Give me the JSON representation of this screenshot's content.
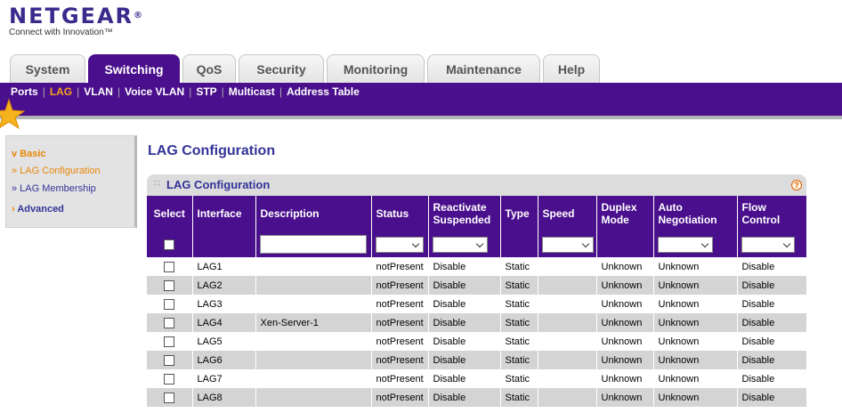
{
  "brand": {
    "name": "NETGEAR",
    "reg": "®",
    "tagline": "Connect with Innovation™"
  },
  "tabs": [
    {
      "label": "System",
      "active": false
    },
    {
      "label": "Switching",
      "active": true
    },
    {
      "label": "QoS",
      "active": false
    },
    {
      "label": "Security",
      "active": false
    },
    {
      "label": "Monitoring",
      "active": false
    },
    {
      "label": "Maintenance",
      "active": false
    },
    {
      "label": "Help",
      "active": false
    }
  ],
  "subnav": [
    {
      "label": "Ports",
      "active": false
    },
    {
      "label": "LAG",
      "active": true
    },
    {
      "label": "VLAN",
      "active": false
    },
    {
      "label": "Voice VLAN",
      "active": false
    },
    {
      "label": "STP",
      "active": false
    },
    {
      "label": "Multicast",
      "active": false
    },
    {
      "label": "Address Table",
      "active": false
    }
  ],
  "sidebar": {
    "basic": "Basic",
    "basic_marker": "v",
    "lag_configuration": "» LAG Configuration",
    "lag_membership": "» LAG Membership",
    "advanced": "Advanced",
    "advanced_marker": "›"
  },
  "page_title": "LAG Configuration",
  "panel": {
    "title": "LAG Configuration",
    "help_glyph": "?"
  },
  "table": {
    "headers": [
      "Select",
      "Interface",
      "Description",
      "Status",
      "Reactivate Suspended",
      "Type",
      "Speed",
      "Duplex Mode",
      "Auto Negotiation",
      "Flow Control"
    ],
    "rows": [
      {
        "interface": "LAG1",
        "description": "",
        "status": "notPresent",
        "reactivate": "Disable",
        "type": "Static",
        "speed": "",
        "duplex": "Unknown",
        "autoneg": "Unknown",
        "flow": "Disable"
      },
      {
        "interface": "LAG2",
        "description": "",
        "status": "notPresent",
        "reactivate": "Disable",
        "type": "Static",
        "speed": "",
        "duplex": "Unknown",
        "autoneg": "Unknown",
        "flow": "Disable"
      },
      {
        "interface": "LAG3",
        "description": "",
        "status": "notPresent",
        "reactivate": "Disable",
        "type": "Static",
        "speed": "",
        "duplex": "Unknown",
        "autoneg": "Unknown",
        "flow": "Disable"
      },
      {
        "interface": "LAG4",
        "description": "Xen-Server-1",
        "status": "notPresent",
        "reactivate": "Disable",
        "type": "Static",
        "speed": "",
        "duplex": "Unknown",
        "autoneg": "Unknown",
        "flow": "Disable"
      },
      {
        "interface": "LAG5",
        "description": "",
        "status": "notPresent",
        "reactivate": "Disable",
        "type": "Static",
        "speed": "",
        "duplex": "Unknown",
        "autoneg": "Unknown",
        "flow": "Disable"
      },
      {
        "interface": "LAG6",
        "description": "",
        "status": "notPresent",
        "reactivate": "Disable",
        "type": "Static",
        "speed": "",
        "duplex": "Unknown",
        "autoneg": "Unknown",
        "flow": "Disable"
      },
      {
        "interface": "LAG7",
        "description": "",
        "status": "notPresent",
        "reactivate": "Disable",
        "type": "Static",
        "speed": "",
        "duplex": "Unknown",
        "autoneg": "Unknown",
        "flow": "Disable"
      },
      {
        "interface": "LAG8",
        "description": "",
        "status": "notPresent",
        "reactivate": "Disable",
        "type": "Static",
        "speed": "",
        "duplex": "Unknown",
        "autoneg": "Unknown",
        "flow": "Disable"
      }
    ]
  },
  "icons": {
    "logo": "netgear-logo",
    "star": "star-icon",
    "help": "help-icon",
    "dropdown": "chevron-down-icon",
    "grip": "drag-handle-icon"
  },
  "colors": {
    "primary": "#4a0f8c",
    "accent": "#f6a21c",
    "link": "#333399",
    "row_alt": "#d4d4d4",
    "help": "#e05a00"
  }
}
